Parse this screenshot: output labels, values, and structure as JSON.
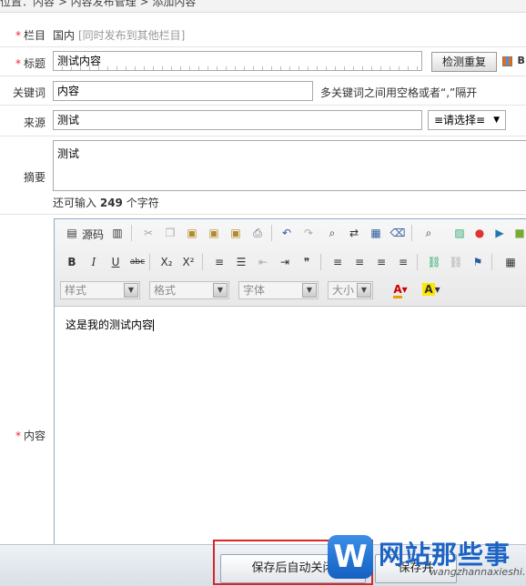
{
  "breadcrumb": "位置：内容 > 内容发布管理 > 添加内容",
  "form": {
    "column": {
      "label": "栏目",
      "value": "国内",
      "note": "[同时发布到其他栏目]"
    },
    "title": {
      "label": "标题",
      "value": "测试内容",
      "check_button": "检测重复",
      "trailing": "B"
    },
    "keywords": {
      "label": "关键词",
      "value": "内容",
      "hint": "多关键词之间用空格或者“,”隔开"
    },
    "source": {
      "label": "来源",
      "value": "测试",
      "select": "≡请选择≡"
    },
    "summary": {
      "label": "摘要",
      "value": "测试",
      "remaining_prefix": "还可输入",
      "remaining_count": "249",
      "remaining_suffix": "个字符"
    },
    "content": {
      "label": "内容",
      "value": "这是我的测试内容"
    }
  },
  "editor": {
    "source_label": "源码",
    "combos": {
      "style": "样式",
      "format": "格式",
      "font": "字体",
      "size": "大小"
    },
    "icons": {
      "bold": "B",
      "italic": "I",
      "underline": "U",
      "strike": "abc",
      "subscript": "X₂",
      "superscript": "X²",
      "ordered_list": "≡",
      "unordered_list": "☰",
      "quote": "❞",
      "text_color": "A",
      "bg_color": "A"
    }
  },
  "footer": {
    "save_close": "保存后自动关闭",
    "save_and": "保存并"
  },
  "watermark": {
    "logo": "W",
    "title": "网站那些事",
    "sub": "wangzhannaxieshi.com"
  }
}
